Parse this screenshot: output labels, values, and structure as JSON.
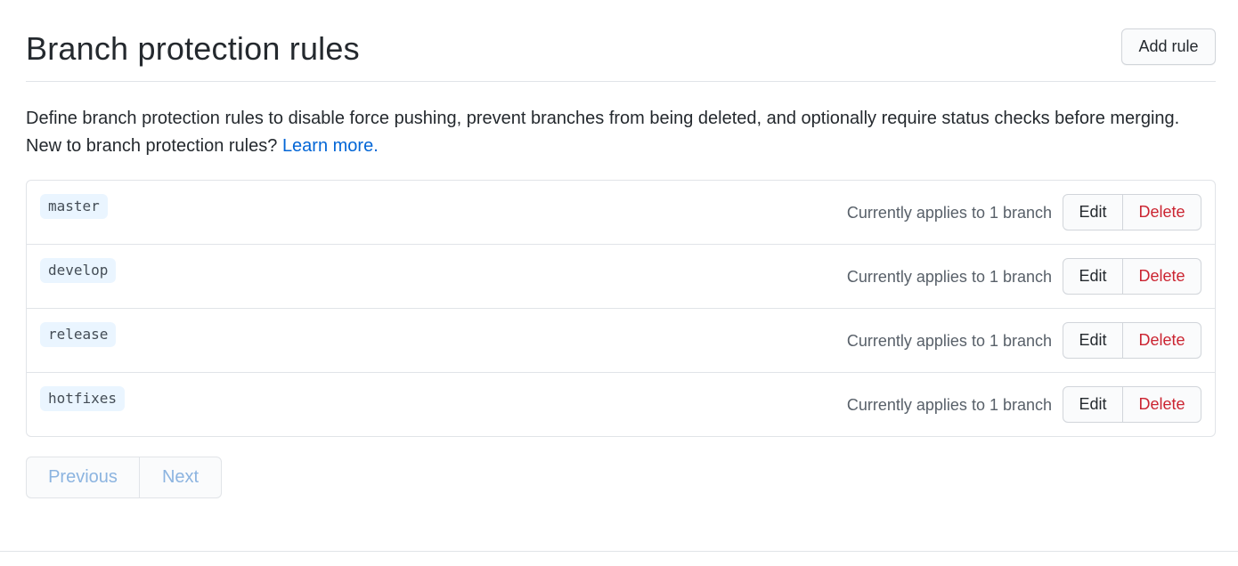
{
  "header": {
    "title": "Branch protection rules",
    "add_rule_label": "Add rule"
  },
  "description": {
    "text": "Define branch protection rules to disable force pushing, prevent branches from being deleted, and optionally require status checks before merging. New to branch protection rules? ",
    "link_text": "Learn more."
  },
  "rules": [
    {
      "branch": "master",
      "applies": "Currently applies to 1 branch",
      "edit_label": "Edit",
      "delete_label": "Delete"
    },
    {
      "branch": "develop",
      "applies": "Currently applies to 1 branch",
      "edit_label": "Edit",
      "delete_label": "Delete"
    },
    {
      "branch": "release",
      "applies": "Currently applies to 1 branch",
      "edit_label": "Edit",
      "delete_label": "Delete"
    },
    {
      "branch": "hotfixes",
      "applies": "Currently applies to 1 branch",
      "edit_label": "Edit",
      "delete_label": "Delete"
    }
  ],
  "pagination": {
    "previous_label": "Previous",
    "next_label": "Next",
    "previous_disabled": true,
    "next_disabled": true
  },
  "colors": {
    "link": "#0366d6",
    "danger": "#cb2431",
    "branch_bg": "#eaf5ff",
    "disabled_pagination": "#8cb4e0"
  }
}
